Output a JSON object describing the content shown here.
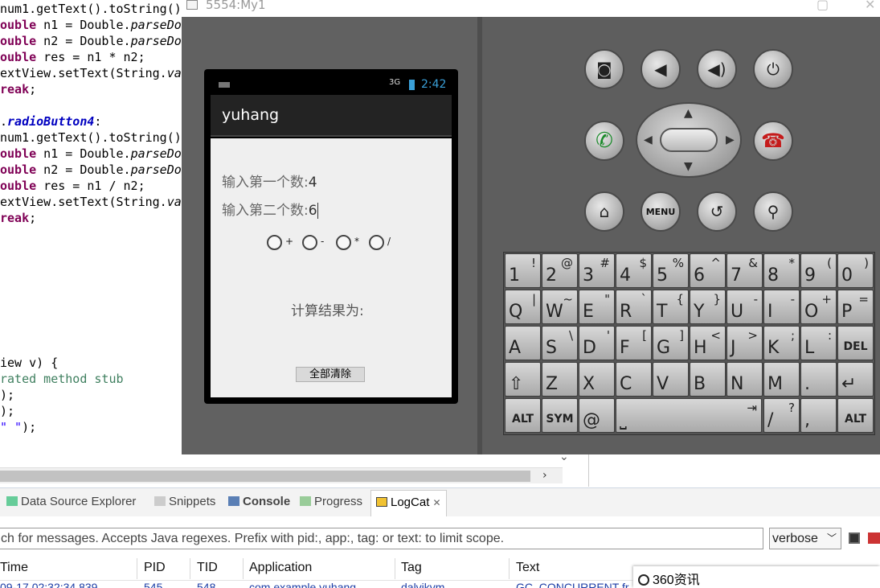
{
  "code_lines": [
    {
      "parts": [
        {
          "t": "num1.getText().toString()",
          "c": ""
        }
      ]
    },
    {
      "parts": [
        {
          "t": "ouble",
          "c": "kw"
        },
        {
          "t": " n1 = Double.",
          "c": ""
        },
        {
          "t": "parseDou",
          "c": "it"
        }
      ]
    },
    {
      "parts": [
        {
          "t": "ouble",
          "c": "kw"
        },
        {
          "t": " n2 = Double.",
          "c": ""
        },
        {
          "t": "parseDou",
          "c": "it"
        }
      ]
    },
    {
      "parts": [
        {
          "t": "ouble",
          "c": "kw"
        },
        {
          "t": " res = n1 * n2;",
          "c": ""
        }
      ]
    },
    {
      "parts": [
        {
          "t": "extView.setText(String.",
          "c": ""
        },
        {
          "t": "val",
          "c": "it"
        }
      ]
    },
    {
      "parts": [
        {
          "t": "reak",
          "c": "kw"
        },
        {
          "t": ";",
          "c": ""
        }
      ]
    },
    {
      "parts": [
        {
          "t": "",
          "c": ""
        }
      ]
    },
    {
      "parts": [
        {
          "t": ".",
          "c": ""
        },
        {
          "t": "radioButton4",
          "c": "fld"
        },
        {
          "t": ":",
          "c": ""
        }
      ]
    },
    {
      "parts": [
        {
          "t": "num1.getText().toString().",
          "c": ""
        }
      ]
    },
    {
      "parts": [
        {
          "t": "ouble",
          "c": "kw"
        },
        {
          "t": " n1 = Double.",
          "c": ""
        },
        {
          "t": "parseDou",
          "c": "it"
        }
      ]
    },
    {
      "parts": [
        {
          "t": "ouble",
          "c": "kw"
        },
        {
          "t": " n2 = Double.",
          "c": ""
        },
        {
          "t": "parseDou",
          "c": "it"
        }
      ]
    },
    {
      "parts": [
        {
          "t": "ouble",
          "c": "kw"
        },
        {
          "t": " res = n1 / n2;",
          "c": ""
        }
      ]
    },
    {
      "parts": [
        {
          "t": "extView.setText(String.",
          "c": ""
        },
        {
          "t": "val",
          "c": "it"
        }
      ]
    },
    {
      "parts": [
        {
          "t": "reak",
          "c": "kw"
        },
        {
          "t": ";",
          "c": ""
        }
      ]
    }
  ],
  "code_lines_lower": [
    {
      "parts": [
        {
          "t": "iew v) {",
          "c": ""
        }
      ]
    },
    {
      "parts": [
        {
          "t": "rated method stub",
          "c": "cm"
        }
      ]
    },
    {
      "parts": [
        {
          "t": ");",
          "c": ""
        }
      ]
    },
    {
      "parts": [
        {
          "t": ");",
          "c": ""
        }
      ]
    },
    {
      "parts": [
        {
          "t": "\" \"",
          "c": "str"
        },
        {
          "t": ");",
          "c": ""
        }
      ]
    }
  ],
  "emulator": {
    "title": "5554:My1",
    "app_title": "yuhang",
    "status_time": "2:42",
    "status_signal": "3G",
    "field1_label": "输入第一个数:",
    "field1_value": "4",
    "field2_label": "输入第二个数:",
    "field2_value": "6",
    "radio_labels": [
      "+",
      "-",
      "*",
      "/"
    ],
    "result_label": "计算结果为:",
    "clear_button": "全部清除",
    "hw_icons": [
      "camera-icon",
      "volume-down-icon",
      "volume-up-icon",
      "power-icon",
      "call-icon",
      "end-call-icon",
      "home-icon",
      "menu-icon",
      "back-icon",
      "search-icon"
    ],
    "menu_label": "MENU"
  },
  "keyboard": {
    "row1": [
      [
        "1",
        "!"
      ],
      [
        "2",
        "@"
      ],
      [
        "3",
        "#"
      ],
      [
        "4",
        "$"
      ],
      [
        "5",
        "%"
      ],
      [
        "6",
        "^"
      ],
      [
        "7",
        "&"
      ],
      [
        "8",
        "*"
      ],
      [
        "9",
        "("
      ],
      [
        "0",
        ")"
      ]
    ],
    "row2": [
      [
        "Q",
        "|"
      ],
      [
        "W",
        "~"
      ],
      [
        "E",
        "\""
      ],
      [
        "R",
        "`"
      ],
      [
        "T",
        "{"
      ],
      [
        "Y",
        "}"
      ],
      [
        "U",
        "-"
      ],
      [
        "I",
        "-"
      ],
      [
        "O",
        "+"
      ],
      [
        "P",
        "="
      ]
    ],
    "row3": [
      [
        "A",
        ""
      ],
      [
        "S",
        "\\"
      ],
      [
        "D",
        "'"
      ],
      [
        "F",
        "["
      ],
      [
        "G",
        "]"
      ],
      [
        "H",
        "<"
      ],
      [
        "J",
        ">"
      ],
      [
        "K",
        ";"
      ],
      [
        "L",
        ":"
      ]
    ],
    "row3_del": "DEL",
    "row4": [
      [
        "Z",
        ""
      ],
      [
        "X",
        ""
      ],
      [
        "C",
        ""
      ],
      [
        "V",
        ""
      ],
      [
        "B",
        ""
      ],
      [
        "N",
        ""
      ],
      [
        "M",
        ""
      ],
      [
        ".",
        ""
      ]
    ],
    "row5_alt": "ALT",
    "row5_sym": "SYM",
    "row5_at": "@",
    "row5_slash": [
      "/",
      "?"
    ],
    "row5_comma": ","
  },
  "tabs": {
    "datasource": "Data Source Explorer",
    "snippets": "Snippets",
    "console": "Console",
    "progress": "Progress",
    "logcat": "LogCat",
    "logcat_close": "✕"
  },
  "logcat": {
    "search_text": "ch for messages. Accepts Java regexes. Prefix with pid:, app:, tag: or text: to limit scope.",
    "level": "verbose",
    "columns": [
      "Time",
      "PID",
      "TID",
      "Application",
      "Tag",
      "Text"
    ],
    "row1": [
      "09-17 02:32:34.839",
      "545",
      "548",
      "com.example.yuhang",
      "dalvikvm",
      "GC_CONCURRENT fr"
    ]
  },
  "news_popup": "360资讯"
}
